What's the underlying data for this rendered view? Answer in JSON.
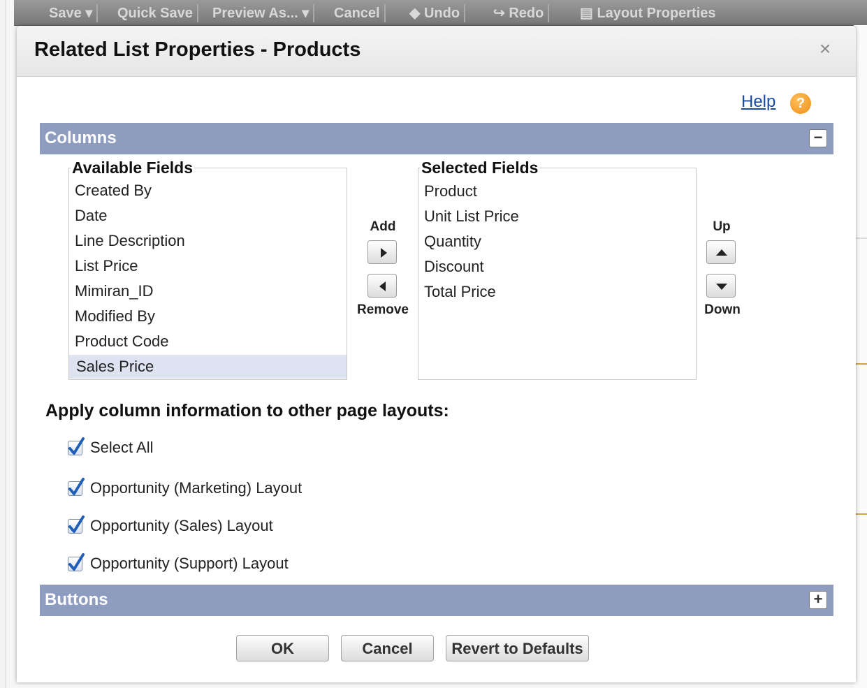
{
  "background_toolbar": {
    "items": [
      "Save ▾",
      "Quick Save",
      "Preview As... ▾",
      "Cancel",
      "◆ Undo",
      "↪ Redo",
      "▤ Layout Properties"
    ]
  },
  "modal": {
    "title": "Related List Properties - Products",
    "close_symbol": "×",
    "help_label": "Help",
    "help_icon_symbol": "?"
  },
  "columns_section": {
    "title": "Columns",
    "toggle_symbol": "−",
    "available_label": "Available Fields",
    "available_fields": [
      "Created By",
      "Date",
      "Line Description",
      "List Price",
      "Mimiran_ID",
      "Modified By",
      "Product Code",
      "Sales Price"
    ],
    "available_selected": "Sales Price",
    "selected_label": "Selected Fields",
    "selected_fields": [
      "Product",
      "Unit List Price",
      "Quantity",
      "Discount",
      "Total Price"
    ],
    "add_label": "Add",
    "remove_label": "Remove",
    "up_label": "Up",
    "down_label": "Down"
  },
  "apply_section": {
    "title": "Apply column information to other page layouts:",
    "checkboxes": [
      {
        "label": "Select All",
        "checked": true
      },
      {
        "label": "Opportunity (Marketing) Layout",
        "checked": true
      },
      {
        "label": "Opportunity (Sales) Layout",
        "checked": true
      },
      {
        "label": "Opportunity (Support) Layout",
        "checked": true
      }
    ]
  },
  "buttons_section": {
    "title": "Buttons",
    "toggle_symbol": "+"
  },
  "footer": {
    "ok_label": "OK",
    "cancel_label": "Cancel",
    "revert_label": "Revert to Defaults"
  },
  "colors": {
    "section_bar": "#8e9dbf",
    "selected_item_bg": "#dde3f1",
    "link": "#1a4b9e",
    "checkmark": "#1f5fb8",
    "help_icon": "#ef8d16"
  }
}
